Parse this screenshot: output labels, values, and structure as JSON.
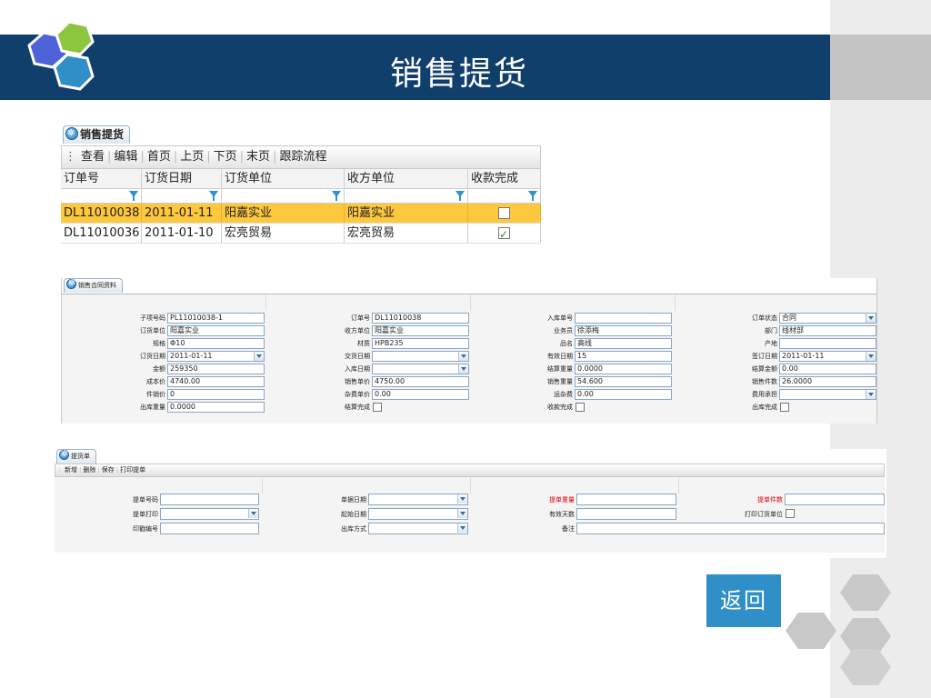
{
  "slide": {
    "title": "销售提货",
    "back_button": "返回",
    "colors": {
      "banner": "#113f6b",
      "accent_blue": "#2f8fc6",
      "selected_row": "#fdc83e",
      "required_label": "#e00000"
    }
  },
  "grid": {
    "tab_label": "销售提货",
    "toolbar": [
      "查看",
      "编辑",
      "首页",
      "上页",
      "下页",
      "末页",
      "跟踪流程"
    ],
    "columns": [
      "订单号",
      "订货日期",
      "订货单位",
      "收方单位",
      "收款完成"
    ],
    "rows": [
      {
        "order_no": "DL11010038",
        "date": "2011-01-11",
        "buyer": "阳嘉实业",
        "receiver": "阳嘉实业",
        "paid": false,
        "selected": true
      },
      {
        "order_no": "DL11010036",
        "date": "2011-01-10",
        "buyer": "宏亮贸易",
        "receiver": "宏亮贸易",
        "paid": true,
        "selected": false
      }
    ]
  },
  "contract": {
    "tab_label": "销售合同资料",
    "fields": {
      "sub_item_no": {
        "label": "子项号码",
        "value": "PL11010038-1"
      },
      "order_no": {
        "label": "订单号",
        "value": "DL11010038"
      },
      "stock_in_no": {
        "label": "入库单号",
        "value": ""
      },
      "order_status": {
        "label": "订单状态",
        "value": "合同"
      },
      "buyer": {
        "label": "订货单位",
        "value": "阳嘉实业"
      },
      "receiver": {
        "label": "收方单位",
        "value": "阳嘉实业"
      },
      "salesman": {
        "label": "业务员",
        "value": "徐添梅"
      },
      "department": {
        "label": "部门",
        "value": "线材部"
      },
      "spec": {
        "label": "规格",
        "value": "Φ10"
      },
      "material": {
        "label": "材质",
        "value": "HPB235"
      },
      "product": {
        "label": "品名",
        "value": "高线"
      },
      "origin": {
        "label": "产地",
        "value": ""
      },
      "order_date": {
        "label": "订货日期",
        "value": "2011-01-11"
      },
      "delivery_date": {
        "label": "交货日期",
        "value": ""
      },
      "valid_days": {
        "label": "有效日期",
        "value": "15"
      },
      "sign_date": {
        "label": "签订日期",
        "value": "2011-01-11"
      },
      "amount": {
        "label": "金额",
        "value": "259350"
      },
      "stock_in_date": {
        "label": "入库日期",
        "value": ""
      },
      "settle_weight": {
        "label": "结算重量",
        "value": "0.0000"
      },
      "settle_amount": {
        "label": "结算金额",
        "value": "0.00"
      },
      "cost_price": {
        "label": "成本价",
        "value": "4740.00"
      },
      "sale_price": {
        "label": "销售单价",
        "value": "4750.00"
      },
      "sale_weight": {
        "label": "销售重量",
        "value": "54.600"
      },
      "sale_pieces": {
        "label": "销售件数",
        "value": "26.0000"
      },
      "piece_price": {
        "label": "件销价",
        "value": "0"
      },
      "misc_price": {
        "label": "杂费单价",
        "value": "0.00"
      },
      "freight": {
        "label": "运杂费",
        "value": "0.00"
      },
      "cost_bearer": {
        "label": "费用承担",
        "value": ""
      },
      "out_weight": {
        "label": "出库重量",
        "value": "0.0000"
      },
      "settled": {
        "label": "结算完成",
        "checked": false
      },
      "paid": {
        "label": "收款完成",
        "checked": false
      },
      "out_done": {
        "label": "出库完成",
        "checked": false
      }
    }
  },
  "delivery": {
    "tab_label": "提货单",
    "toolbar": [
      "新增",
      "删除",
      "保存",
      "打印提单"
    ],
    "fields": {
      "bill_no": {
        "label": "提单号码",
        "value": ""
      },
      "doc_date": {
        "label": "单据日期",
        "value": ""
      },
      "bill_weight": {
        "label": "提单重量",
        "value": ""
      },
      "bill_pieces": {
        "label": "提单件数",
        "value": ""
      },
      "bill_print": {
        "label": "提单打印",
        "value": ""
      },
      "start_date": {
        "label": "起始日期",
        "value": ""
      },
      "valid_days": {
        "label": "有效天数",
        "value": ""
      },
      "print_buyer": {
        "label": "打印订货单位",
        "checked": false
      },
      "seal_no": {
        "label": "印戳编号",
        "value": ""
      },
      "out_method": {
        "label": "出库方式",
        "value": ""
      },
      "remark": {
        "label": "备注",
        "value": ""
      }
    }
  }
}
